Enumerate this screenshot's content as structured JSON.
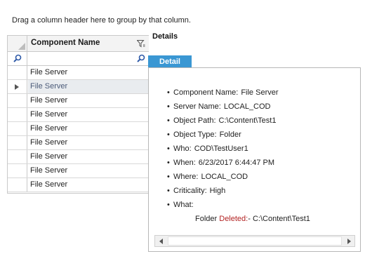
{
  "group_panel": {
    "hint": "Drag a column header here to group by that column."
  },
  "grid": {
    "column_header": "Component Name",
    "filter_value": "",
    "rows": [
      {
        "component_name": "File Server",
        "selected": false
      },
      {
        "component_name": "File Server",
        "selected": true
      },
      {
        "component_name": "File Server",
        "selected": false
      },
      {
        "component_name": "File Server",
        "selected": false
      },
      {
        "component_name": "File Server",
        "selected": false
      },
      {
        "component_name": "File Server",
        "selected": false
      },
      {
        "component_name": "File Server",
        "selected": false
      },
      {
        "component_name": "File Server",
        "selected": false
      },
      {
        "component_name": "File Server",
        "selected": false
      }
    ]
  },
  "details": {
    "title": "Details",
    "tab_label": "Detail",
    "bullet": "•",
    "fields": [
      {
        "label": "Component Name:",
        "value": "File Server"
      },
      {
        "label": "Server Name:",
        "value": "LOCAL_COD"
      },
      {
        "label": "Object Path:",
        "value": "C:\\Content\\Test1"
      },
      {
        "label": "Object Type:",
        "value": "Folder"
      },
      {
        "label": "Who:",
        "value": "COD\\TestUser1"
      },
      {
        "label": "When:",
        "value": "6/23/2017 6:44:47 PM"
      },
      {
        "label": "Where:",
        "value": "LOCAL_COD"
      },
      {
        "label": "Criticality:",
        "value": "High"
      },
      {
        "label": "What:",
        "value": ""
      }
    ],
    "what": {
      "object_type": "Folder",
      "action": "Deleted:",
      "separator": "-",
      "path": "C:\\Content\\Test1"
    }
  },
  "colors": {
    "tab_accent": "#3a97d3",
    "deleted_text": "#b22222",
    "selected_row_text": "#4a5a78"
  },
  "icons": {
    "column_filter": "filter-icon",
    "row_filter_search": "search-icon",
    "row_indicator": "caret-right-icon",
    "scroll_left": "chevron-left-icon",
    "scroll_right": "chevron-right-icon"
  }
}
